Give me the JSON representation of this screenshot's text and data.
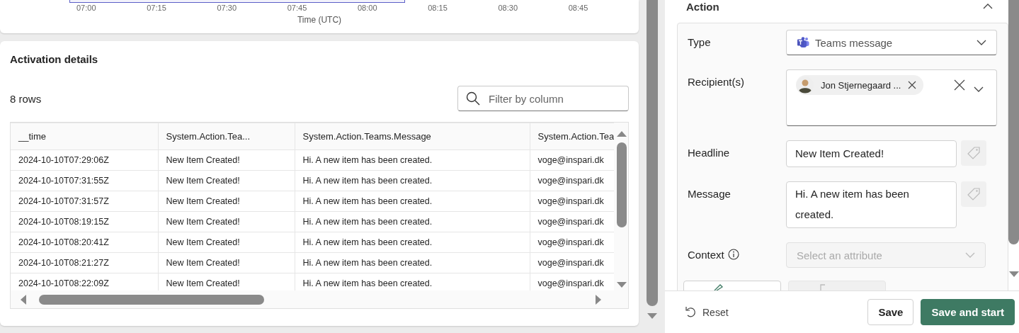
{
  "chart": {
    "xticks": [
      "07:00",
      "07:15",
      "07:30",
      "07:45",
      "08:00",
      "08:15",
      "08:30",
      "08:45"
    ],
    "xlabel": "Time (UTC)"
  },
  "activation_details": {
    "title": "Activation details",
    "row_count": "8 rows",
    "filter": {
      "placeholder": "Filter by column"
    },
    "columns": [
      "__time",
      "System.Action.Tea...",
      "System.Action.Teams.Message",
      "System.Action.Tea"
    ],
    "rows": [
      [
        "2024-10-10T07:29:06Z",
        "New Item Created!",
        "Hi. A new item has been created.",
        "voge@inspari.dk"
      ],
      [
        "2024-10-10T07:31:55Z",
        "New Item Created!",
        "Hi. A new item has been created.",
        "voge@inspari.dk"
      ],
      [
        "2024-10-10T07:31:57Z",
        "New Item Created!",
        "Hi. A new item has been created.",
        "voge@inspari.dk"
      ],
      [
        "2024-10-10T08:19:15Z",
        "New Item Created!",
        "Hi. A new item has been created.",
        "voge@inspari.dk"
      ],
      [
        "2024-10-10T08:20:41Z",
        "New Item Created!",
        "Hi. A new item has been created.",
        "voge@inspari.dk"
      ],
      [
        "2024-10-10T08:21:27Z",
        "New Item Created!",
        "Hi. A new item has been created.",
        "voge@inspari.dk"
      ],
      [
        "2024-10-10T08:22:09Z",
        "New Item Created!",
        "Hi. A new item has been created.",
        "voge@inspari.dk"
      ]
    ]
  },
  "action": {
    "title": "Action",
    "expanded": true,
    "fields": [
      {
        "kind": "select",
        "label": "Type",
        "value": "Teams message",
        "disabled": false
      },
      {
        "kind": "people",
        "label": "Recipient(s)",
        "chips": [
          "Jon Stjernegaard ..."
        ],
        "disabled": false
      },
      {
        "kind": "text",
        "label": "Headline",
        "value": "New Item Created!",
        "disabled": false
      },
      {
        "kind": "textarea",
        "label": "Message",
        "value": "Hi. A new item has been created.",
        "disabled": false
      },
      {
        "kind": "select",
        "label": "Context",
        "info": true,
        "placeholder": "Select an attribute",
        "disabled": true
      }
    ]
  },
  "footer": {
    "reset": "Reset",
    "buttons": [
      {
        "label": "Save",
        "primary": false
      },
      {
        "label": "Save and start",
        "primary": true
      }
    ]
  }
}
